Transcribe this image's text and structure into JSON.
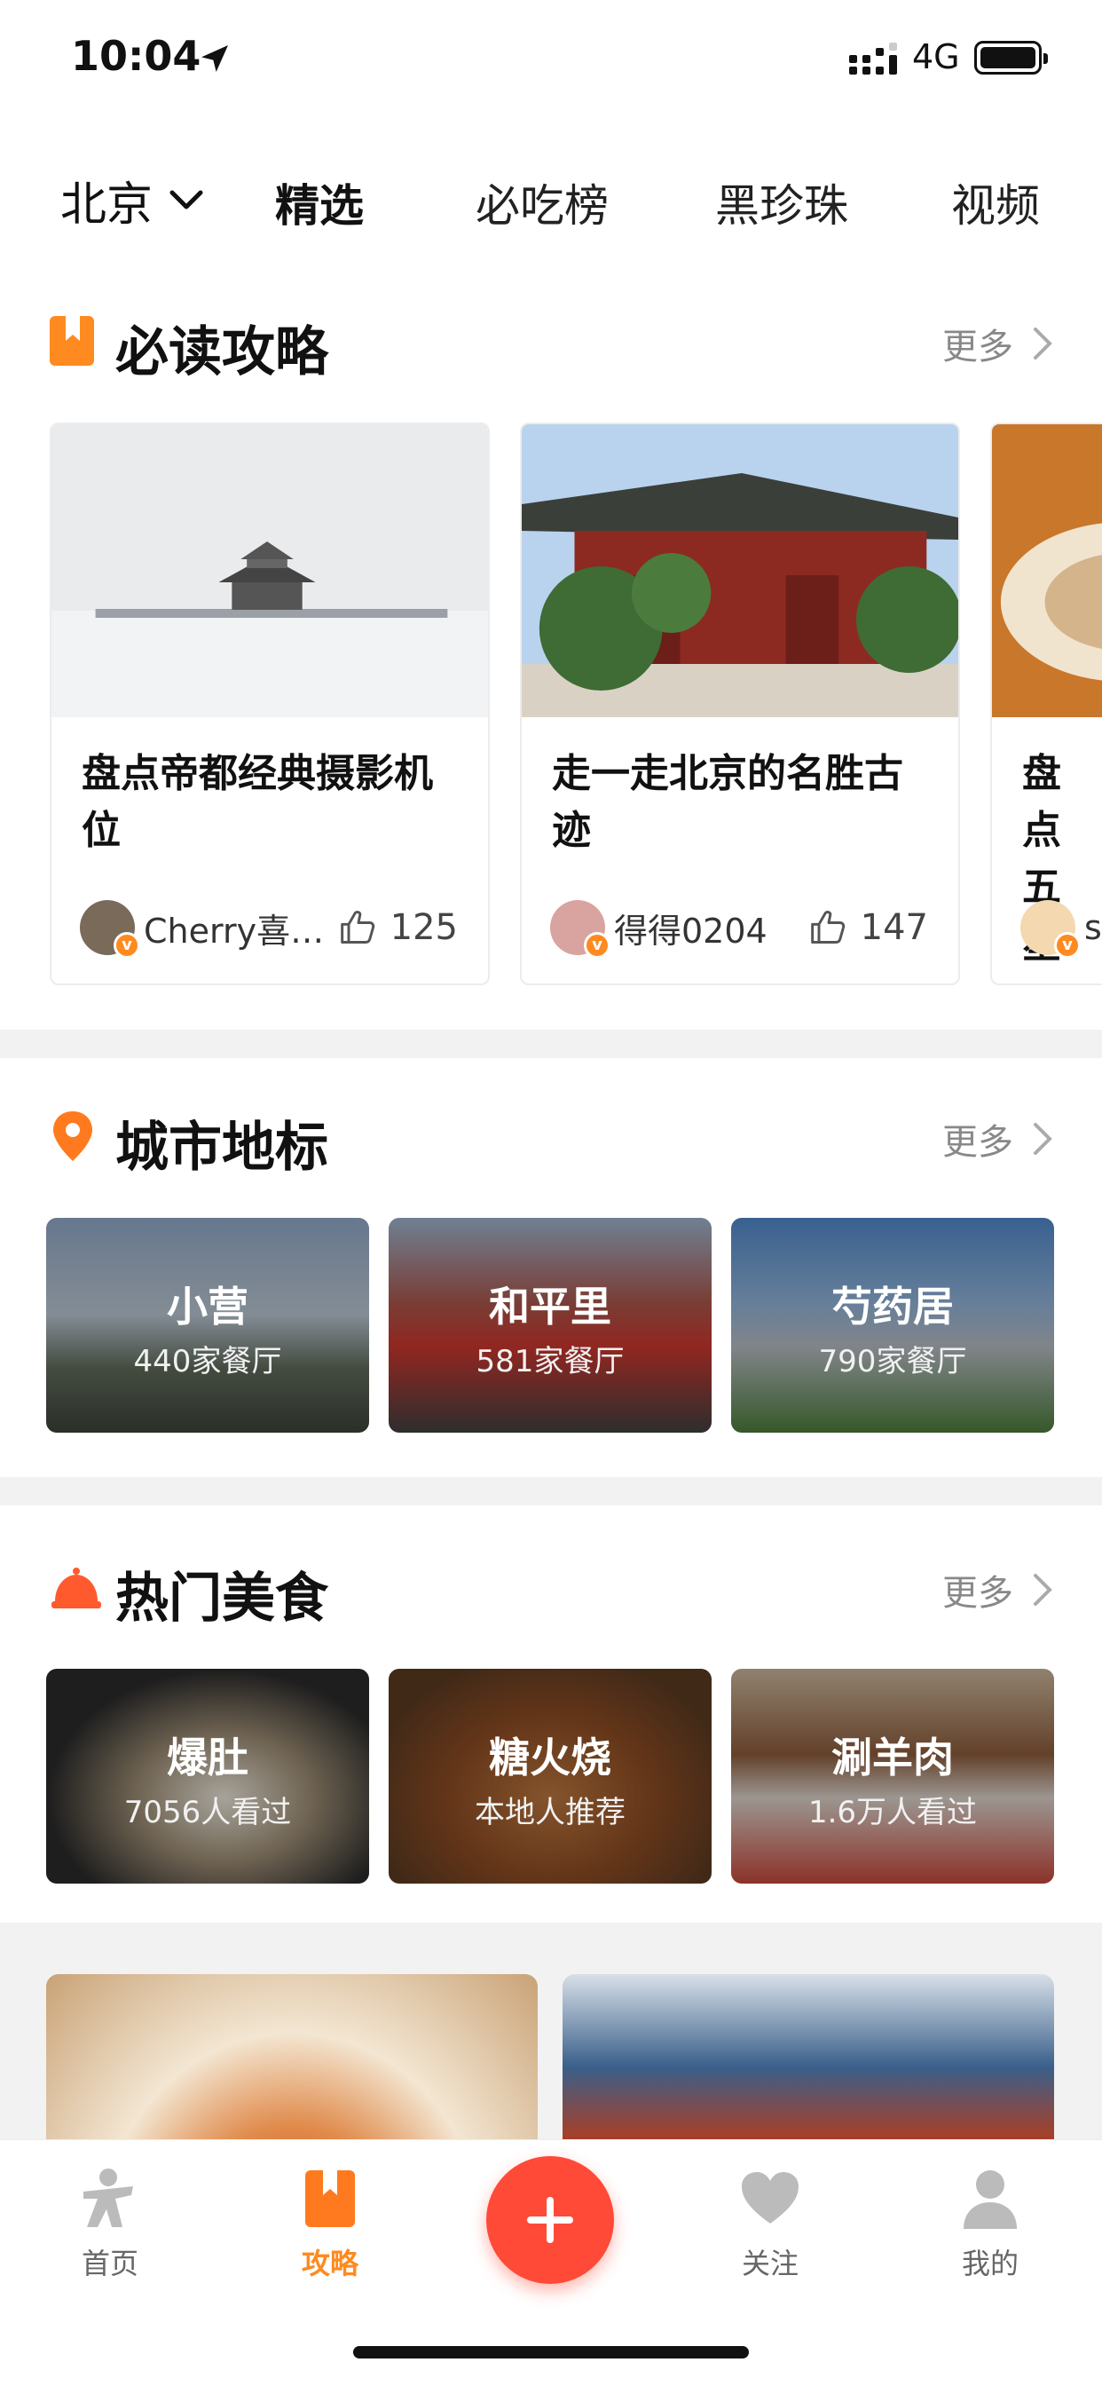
{
  "status_bar": {
    "time": "10:04",
    "network": "4G"
  },
  "top_nav": {
    "city": "北京",
    "tabs": [
      {
        "label": "精选",
        "active": true
      },
      {
        "label": "必吃榜"
      },
      {
        "label": "黑珍珠"
      },
      {
        "label": "视频"
      }
    ]
  },
  "sections": {
    "guides": {
      "title": "必读攻略",
      "more": "更多",
      "cards": [
        {
          "title": "盘点帝都经典摄影机位",
          "author": "Cherry喜…",
          "likes": "125"
        },
        {
          "title": "走一走北京的名胜古迹",
          "author": "得得0204",
          "likes": "147"
        },
        {
          "title": "盘点五星",
          "author": "su"
        }
      ]
    },
    "landmarks": {
      "title": "城市地标",
      "more": "更多",
      "tiles": [
        {
          "name": "小营",
          "sub": "440家餐厅"
        },
        {
          "name": "和平里",
          "sub": "581家餐厅"
        },
        {
          "name": "芍药居",
          "sub": "790家餐厅"
        }
      ]
    },
    "food": {
      "title": "热门美食",
      "more": "更多",
      "tiles": [
        {
          "name": "爆肚",
          "sub": "7056人看过"
        },
        {
          "name": "糖火烧",
          "sub": "本地人推荐"
        },
        {
          "name": "涮羊肉",
          "sub": "1.6万人看过"
        }
      ]
    }
  },
  "tab_bar": {
    "items": [
      {
        "label": "首页",
        "icon": "home-person-icon"
      },
      {
        "label": "攻略",
        "icon": "bookmark-icon",
        "active": true
      },
      {
        "label": "",
        "icon": "plus-icon"
      },
      {
        "label": "关注",
        "icon": "heart-icon"
      },
      {
        "label": "我的",
        "icon": "user-icon"
      }
    ]
  },
  "colors": {
    "accent": "#ff8a1f",
    "brand_red": "#ff4a38",
    "underline": "#ff6a3d"
  }
}
